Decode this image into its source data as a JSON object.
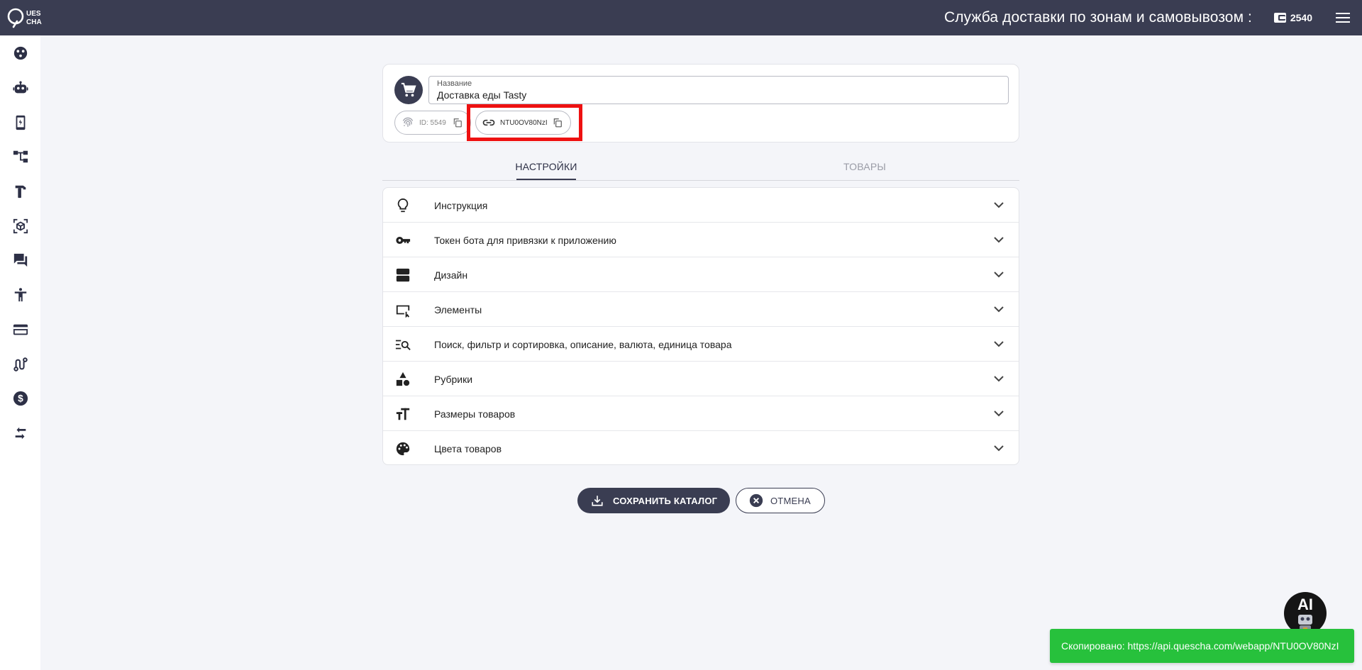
{
  "header": {
    "logo_text_top": "UES",
    "logo_text_bottom": "CHA",
    "title": "Служба доставки по зонам и самовывозом :",
    "balance": "2540"
  },
  "sidebar": {
    "items": [
      {
        "icon": "dashboard-icon"
      },
      {
        "icon": "robot-icon"
      },
      {
        "icon": "mobile-app-icon"
      },
      {
        "icon": "flow-icon"
      },
      {
        "icon": "hammer-icon"
      },
      {
        "icon": "cube-scan-icon"
      },
      {
        "icon": "chat-icon"
      },
      {
        "icon": "accessibility-icon"
      },
      {
        "icon": "credit-card-icon"
      },
      {
        "icon": "route-icon"
      },
      {
        "icon": "dollar-icon"
      },
      {
        "icon": "swap-icon"
      }
    ]
  },
  "catalog": {
    "name_label": "Название",
    "name_value": "Доставка еды Tasty",
    "id_label": "ID: 5549",
    "link_code": "NTU0OV80NzI"
  },
  "tabs": [
    {
      "label": "НАСТРОЙКИ",
      "active": true
    },
    {
      "label": "ТОВАРЫ",
      "active": false
    }
  ],
  "sections": [
    {
      "label": "Инструкция",
      "icon": "lightbulb-icon"
    },
    {
      "label": "Токен бота для привязки к приложению",
      "icon": "key-icon"
    },
    {
      "label": "Дизайн",
      "icon": "design-icon"
    },
    {
      "label": "Элементы",
      "icon": "elements-icon"
    },
    {
      "label": "Поиск, фильтр и сортировка, описание, валюта, единица товара",
      "icon": "search-list-icon"
    },
    {
      "label": "Рубрики",
      "icon": "category-icon"
    },
    {
      "label": "Размеры товаров",
      "icon": "text-size-icon"
    },
    {
      "label": "Цвета товаров",
      "icon": "palette-icon"
    }
  ],
  "actions": {
    "save_label": "СОХРАНИТЬ КАТАЛОГ",
    "cancel_label": "ОТМЕНА"
  },
  "ai_button": {
    "label": "AI"
  },
  "toast": {
    "text": "Скопировано: https://api.quescha.com/webapp/NTU0OV80NzI"
  },
  "colors": {
    "primary": "#3a3d52",
    "toast": "#27c13c",
    "highlight": "#ee1111"
  }
}
